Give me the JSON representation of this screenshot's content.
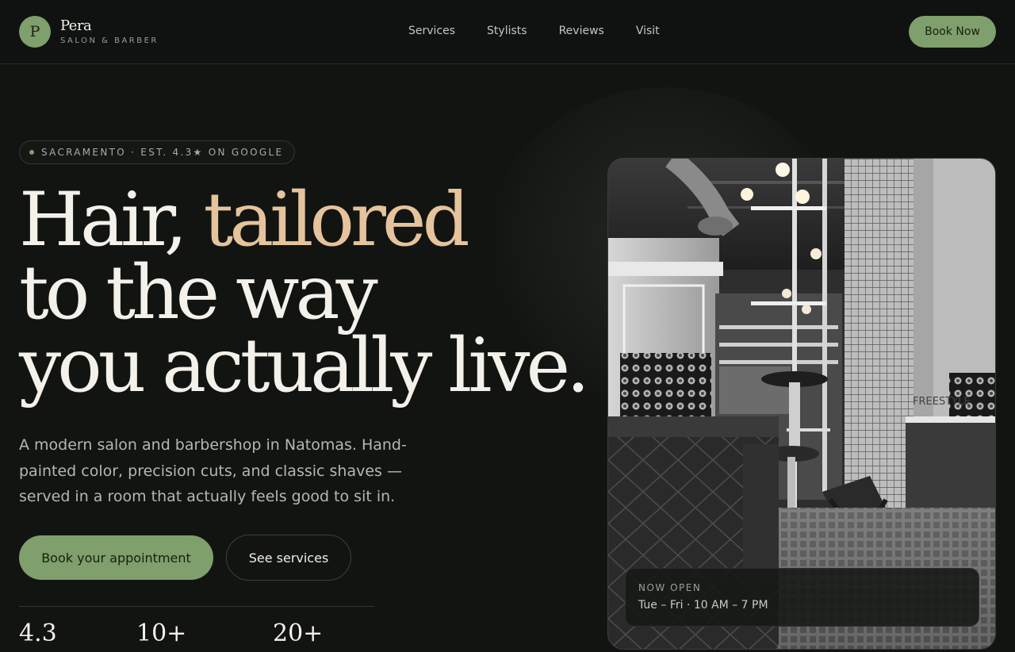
{
  "brand": {
    "initial": "P",
    "name": "Pera",
    "tagline": "SALON & BARBER"
  },
  "nav": {
    "items": [
      "Services",
      "Stylists",
      "Reviews",
      "Visit"
    ],
    "cta": "Book Now"
  },
  "hero": {
    "badge": "SACRAMENTO · EST. 4.3★ ON GOOGLE",
    "headline": {
      "line1_plain": "Hair, ",
      "line1_accent": "tailored",
      "line2": "to the way",
      "line3": "you actually live."
    },
    "lede": "A modern salon and barbershop in Natomas. Hand-painted color, precision cuts, and classic shaves — served in a room that actually feels good to sit in.",
    "primary_cta": "Book your appointment",
    "secondary_cta": "See services",
    "stats": [
      "4.3",
      "10+",
      "20+"
    ]
  },
  "photo": {
    "sign_text": "FREESTYLE"
  },
  "hours_card": {
    "label": "NOW OPEN",
    "hours": "Tue – Fri · 10 AM – 7 PM"
  },
  "colors": {
    "accent_green": "#7f9f6c",
    "accent_tan": "#e5c39c",
    "background": "#121412"
  }
}
